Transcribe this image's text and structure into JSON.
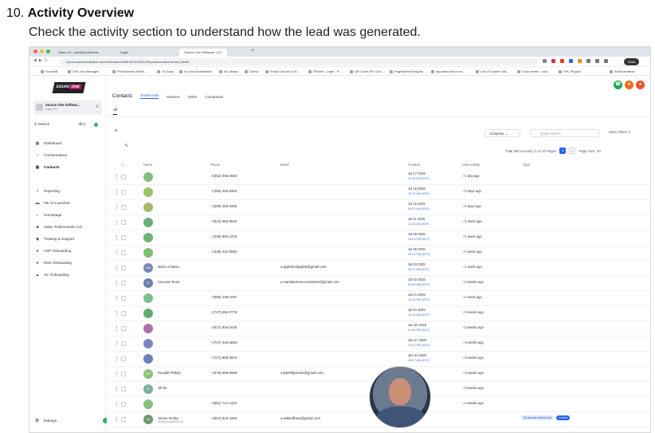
{
  "step": {
    "number": "10.",
    "title": "Activity Overview",
    "description": "Check the activity section to understand how the lead was generated."
  },
  "browser": {
    "tabs": [
      "Video LD - yolo@sourceone...",
      "Login",
      "Source One Software, LLC"
    ],
    "url": "my.sourceonesoftware.com/v2/location/xb5lC9PnCN0/KuRqurza/contacts/smart_list/All",
    "profile": "Work",
    "bookmarks": [
      "GrowthB",
      "GHL Info Manager...",
      "FB Business Settin...",
      "14 Days",
      "AI Lead Automation",
      "All Library",
      "Canva",
      "Email Checker & B...",
      "SPanel - Login - H...",
      "QR Code API: Doc...",
      "PageSpeed Insights",
      "app.adsource.com...",
      "List of Custom Val...",
      "Color wheel - colo...",
      "SHL Plugins",
      "All Bookmarks"
    ]
  },
  "sidebar": {
    "logo_text": "SOURCE",
    "logo_accent": "ONE",
    "account_name": "Source One Softwar...",
    "account_sub": "Lake, FL",
    "search_label": "Search",
    "search_kbd": "⌘ K",
    "items": [
      {
        "label": "Dashboard",
        "icon": "dashboard-icon"
      },
      {
        "label": "Conversations",
        "icon": "chat-icon"
      },
      {
        "label": "Contacts",
        "icon": "contacts-icon"
      },
      {
        "label": "Reporting",
        "icon": "chart-icon"
      },
      {
        "label": "FB Ad Launcher",
        "icon": "rocket-icon"
      },
      {
        "label": "Homepage",
        "icon": "home-icon"
      },
      {
        "label": "Video Testimonials CVs",
        "icon": "video-icon"
      },
      {
        "label": "Training & Support",
        "icon": "graduation-icon"
      },
      {
        "label": "ASP Onboarding",
        "icon": "people-icon"
      },
      {
        "label": "EMA Onboarding",
        "icon": "pin-icon"
      },
      {
        "label": "SC Onboarding",
        "icon": "group-icon"
      }
    ],
    "settings_label": "Settings"
  },
  "main": {
    "title": "Contacts",
    "tabs": [
      "Smart Lists",
      "Restore",
      "Tasks",
      "Companies"
    ],
    "subtab": "All",
    "columns_label": "Columns",
    "search_placeholder": "Quick search",
    "more_filters": "More Filters",
    "pager_text": "Total 282 records | 1 of 15 Pages",
    "page_current": "1",
    "page_next": ">",
    "page_size": "Page Size: 20",
    "headers": {
      "name": "Name",
      "phone": "Phone",
      "email": "Email",
      "created": "Created",
      "last_activity": "Last Activity",
      "tags": "Tags"
    }
  },
  "rows": [
    {
      "initials": "",
      "name": "",
      "phone": "(352) 356-2563",
      "email": "",
      "date": "Jul 17 2025",
      "time": "11:28 AM (EDT)",
      "activity": "1 day ago",
      "color": "#7fbf7f"
    },
    {
      "initials": "",
      "name": "",
      "phone": "(386) 260-5363",
      "email": "",
      "date": "Jul 16 2025",
      "time": "10:37 AM (EDT)",
      "activity": "2 days ago",
      "color": "#9cc26a"
    },
    {
      "initials": "",
      "name": "",
      "phone": "(386) 260-0485",
      "email": "",
      "date": "Jul 16 2025",
      "time": "09:22 AM (EDT)",
      "activity": "2 days ago",
      "color": "#a5b86a"
    },
    {
      "initials": "",
      "name": "",
      "phone": "(813) 682-9932",
      "email": "",
      "date": "Jul 11 2025",
      "time": "11:52 AM (EDT)",
      "activity": "1 week ago",
      "color": "#6ab07a"
    },
    {
      "initials": "",
      "name": "",
      "phone": "(239) 860-1219",
      "email": "",
      "date": "Jul 09 2025",
      "time": "03:03 PM (EDT)",
      "activity": "1 week ago",
      "color": "#6fb36f"
    },
    {
      "initials": "",
      "name": "",
      "phone": "(248) 431-5064",
      "email": "",
      "date": "Jul 06 2025",
      "time": "09:14 PM (EDT)",
      "activity": "1 week ago",
      "color": "#7cbf74"
    },
    {
      "initials": "MA",
      "name": "Marco Antonio",
      "phone": "",
      "email": "appletestapp83@gmail.com",
      "date": "Jul 03 2025",
      "time": "04:01 AM (EDT)",
      "activity": "1 week ago",
      "color": "#7b86b8"
    },
    {
      "initials": "ST",
      "name": "Success Team",
      "phone": "",
      "email": "martialartssuccessteam@gmail.com",
      "date": "Jul 02 2025",
      "time": "06:25 AM (EDT)",
      "activity": "2 weeks ago",
      "color": "#6d7fae"
    },
    {
      "initials": "",
      "name": "",
      "phone": "(985) 239-1087",
      "email": "",
      "date": "Jul 01 2025",
      "time": "12:39 PM (EDT)",
      "activity": "1 week ago",
      "color": "#7cc08a"
    },
    {
      "initials": "",
      "name": "",
      "phone": "(727) 656-2776",
      "email": "",
      "date": "Jul 01 2025",
      "time": "10:40 AM (EDT)",
      "activity": "2 weeks ago",
      "color": "#5fae6f"
    },
    {
      "initials": "",
      "name": "",
      "phone": "(813) 806-1645",
      "email": "",
      "date": "Jun 30 2025",
      "time": "01:46 PM (EDT)",
      "activity": "2 weeks ago",
      "color": "#b06fa8"
    },
    {
      "initials": "",
      "name": "",
      "phone": "(737) 315-5650",
      "email": "",
      "date": "Jun 27 2025",
      "time": "12:57 PM (EDT)",
      "activity": "3 weeks ago",
      "color": "#7a86c4"
    },
    {
      "initials": "",
      "name": "",
      "phone": "(727) 808-2910",
      "email": "",
      "date": "Jun 23 2025",
      "time": "10:07 AM (EDT)",
      "activity": "3 weeks ago",
      "color": "#6f7fb9"
    },
    {
      "initials": "RP",
      "name": "Randall Phillips",
      "phone": "(678) 595-9859",
      "email": "rbphillipswine@gmail.com",
      "date": "2025",
      "time": "AM",
      "activity": "3 weeks ago",
      "color": "#8dc07a"
    },
    {
      "initials": "JT",
      "name": "Jill Tai",
      "phone": "",
      "email": "",
      "date": "2025",
      "time": "AM",
      "activity": "3 weeks ago",
      "color": "#7ab0a0"
    },
    {
      "initials": "",
      "name": "",
      "phone": "(561) 741-1410",
      "email": "",
      "date": "2025",
      "time": "PM",
      "activity": "4 weeks ago",
      "color": "#88bf7a"
    },
    {
      "initials": "JS",
      "name": "James Smiley",
      "name2": "Smiley Academy LLC",
      "phone": "(904) 815-3494",
      "email": "oakleafbest@gmail.com",
      "date": "2025",
      "time": "PM",
      "activity": "",
      "color": "#6f9a6f",
      "tags": [
        "ibc inbound website form",
        "ml lead"
      ]
    }
  ]
}
